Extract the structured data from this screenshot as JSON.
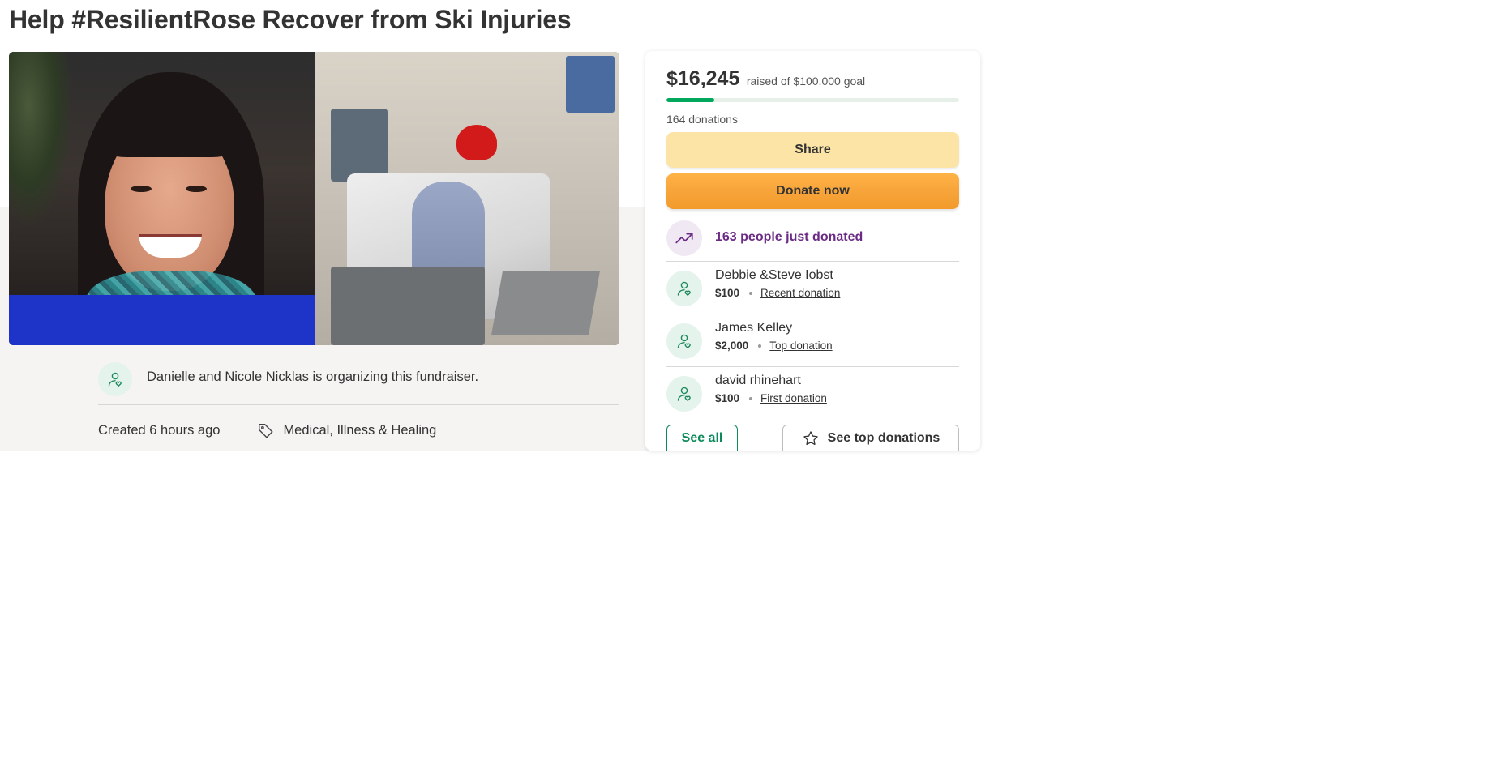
{
  "campaign": {
    "title": "Help #ResilientRose Recover from Ski Injuries",
    "organizer_text": "Danielle and Nicole Nicklas is organizing this fundraiser.",
    "created": "Created 6 hours ago",
    "category": "Medical, Illness & Healing"
  },
  "sidebar": {
    "raised_amount": "$16,245",
    "goal_text": "raised of $100,000 goal",
    "progress_fraction": 0.16245,
    "donations_count": "164 donations",
    "share_label": "Share",
    "donate_label": "Donate now",
    "trend_text": "163 people just donated",
    "donations": [
      {
        "name": "Debbie &Steve Iobst",
        "amount": "$100",
        "kind": "Recent donation"
      },
      {
        "name": "James Kelley",
        "amount": "$2,000",
        "kind": "Top donation"
      },
      {
        "name": "david rhinehart",
        "amount": "$100",
        "kind": "First donation"
      }
    ],
    "see_all_label": "See all",
    "see_top_label": "See top donations"
  },
  "colors": {
    "progress": "#02a95c",
    "share_button": "#fce3a6",
    "donate_button": "#f7a43a",
    "trend_text": "#6b2a85",
    "see_all": "#0b8a5a"
  },
  "icons": {
    "organizer": "user-heart-icon",
    "category": "tag-icon",
    "trend": "trending-up-icon",
    "donor": "user-heart-icon",
    "see_top": "star-icon"
  }
}
